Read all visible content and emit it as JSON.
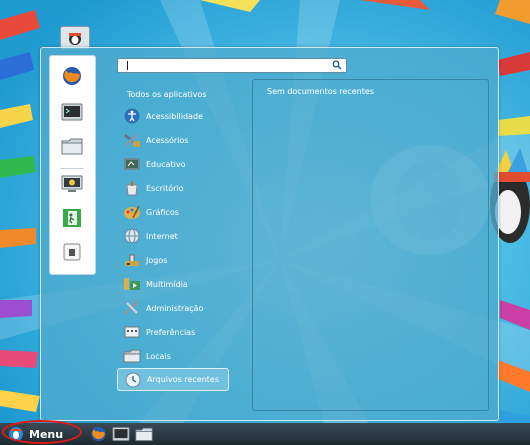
{
  "search": {
    "value": "",
    "placeholder": ""
  },
  "categories_header": "Todos os aplicativos",
  "categories": [
    {
      "label": "Acessibilidade",
      "icon": "accessibility-icon"
    },
    {
      "label": "Acessórios",
      "icon": "accessories-icon"
    },
    {
      "label": "Educativo",
      "icon": "education-icon"
    },
    {
      "label": "Escritório",
      "icon": "office-icon"
    },
    {
      "label": "Gráficos",
      "icon": "graphics-icon"
    },
    {
      "label": "Internet",
      "icon": "internet-icon"
    },
    {
      "label": "Jogos",
      "icon": "games-icon"
    },
    {
      "label": "Multimídia",
      "icon": "multimedia-icon"
    },
    {
      "label": "Administração",
      "icon": "administration-icon"
    },
    {
      "label": "Preferências",
      "icon": "preferences-icon"
    },
    {
      "label": "Locais",
      "icon": "places-icon"
    },
    {
      "label": "Arquivos recentes",
      "icon": "recent-files-icon"
    }
  ],
  "selected_category": "Arquivos recentes",
  "recent_documents_message": "Sem documentos recentes",
  "favorites": [
    "firefox-icon",
    "terminal-icon",
    "file-manager-icon",
    "system-monitor-icon",
    "logout-icon",
    "lock-screen-icon"
  ],
  "taskbar": {
    "menu_label": "Menu",
    "launchers": [
      "firefox-icon",
      "terminal-icon",
      "file-manager-icon"
    ]
  },
  "colors": {
    "panel_bg": "#4eabcd",
    "highlight_ring": "#e01818",
    "taskbar": "#2a3842",
    "background": "#3fb3e0"
  }
}
